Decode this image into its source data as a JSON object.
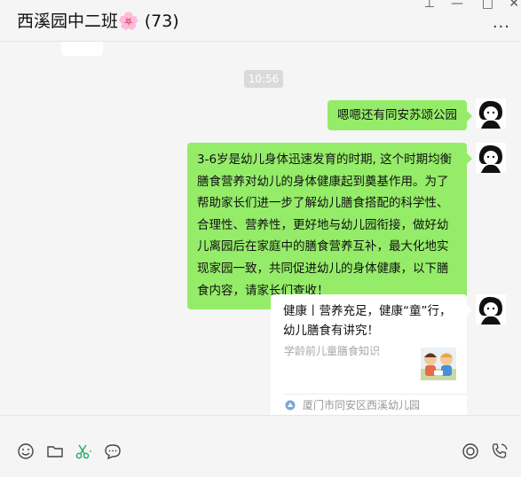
{
  "window": {
    "title": "西溪园中二班🌸",
    "member_count": "(73)",
    "pin_glyph": "⊥",
    "minimize_glyph": "—",
    "maximize_glyph": "□",
    "close_glyph": "✕",
    "more_glyph": "···"
  },
  "chat": {
    "timestamp": "10:56",
    "messages": [
      {
        "type": "text",
        "sender": "self",
        "text": "嗯嗯还有同安苏颂公园"
      },
      {
        "type": "text",
        "sender": "self",
        "text": "3-6岁是幼儿身体迅速发育的时期, 这个时期均衡膳食营养对幼儿的身体健康起到奠基作用。为了帮助家长们进一步了解幼儿膳食搭配的科学性、合理性、营养性，更好地与幼儿园衔接，做好幼儿离园后在家庭中的膳食营养互补，最大化地实现家园一致，共同促进幼儿的身体健康，以下膳食内容，请家长们查收！"
      },
      {
        "type": "link_card",
        "sender": "self",
        "title": "健康丨营养充足，健康“童”行，幼儿膳食有讲究！",
        "description": "学龄前儿童膳食知识",
        "source": "厦门市同安区西溪幼儿园"
      }
    ]
  },
  "toolbar": {
    "icons": [
      "emoji-icon",
      "folder-icon",
      "scissors-icon",
      "chat-bubble-icon",
      "video-call-icon",
      "phone-call-icon"
    ],
    "accent_color": "#2aae67"
  },
  "colors": {
    "self_bubble": "#95ec69",
    "background": "#f5f5f5"
  }
}
